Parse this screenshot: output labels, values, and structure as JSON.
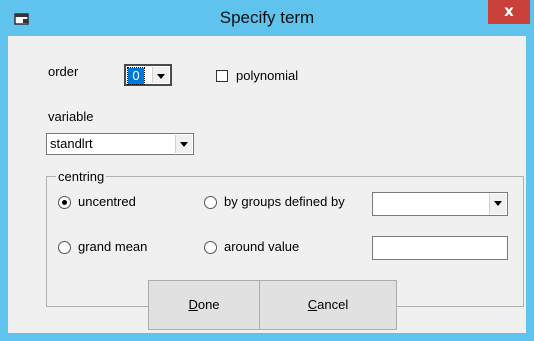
{
  "window": {
    "title": "Specify term",
    "close_glyph": "x",
    "title_icon": "window-icon",
    "close_color": "#c9403a",
    "frame_color": "#5fc3ee"
  },
  "order": {
    "label": "order",
    "value": "0"
  },
  "polynomial": {
    "label": "polynomial",
    "checked": false
  },
  "variable": {
    "label": "variable",
    "value": "standlrt"
  },
  "centring": {
    "title": "centring",
    "options": {
      "uncentred": {
        "label": "uncentred",
        "selected": true
      },
      "groups": {
        "label": "by groups defined by",
        "selected": false
      },
      "grand_mean": {
        "label": "grand mean",
        "selected": false
      },
      "around_value": {
        "label": "around value",
        "selected": false
      }
    },
    "groups_value": "",
    "around_value": ""
  },
  "buttons": {
    "done": {
      "first": "D",
      "rest": "one"
    },
    "cancel": {
      "first": "C",
      "rest": "ancel"
    }
  }
}
